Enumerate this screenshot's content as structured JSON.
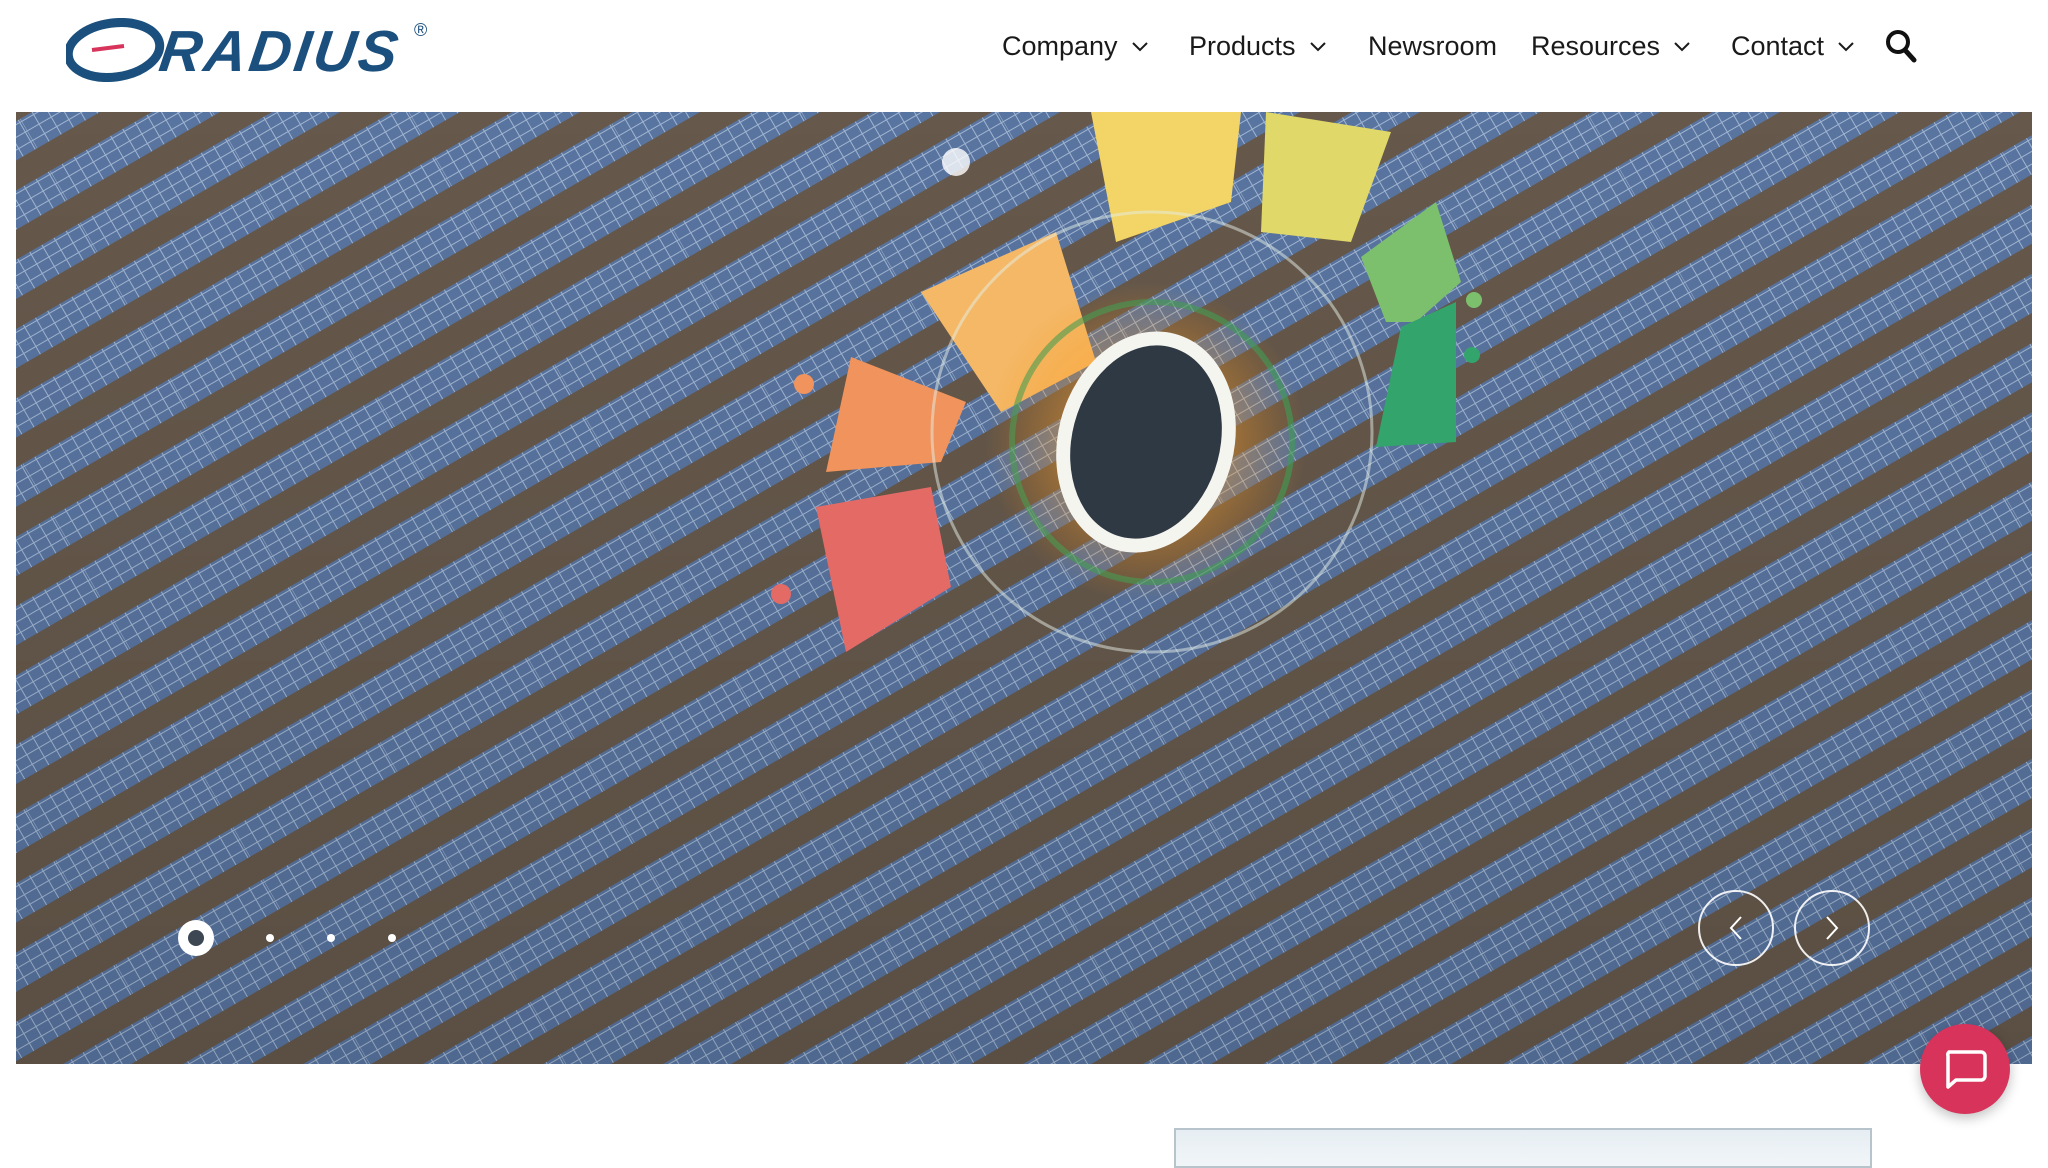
{
  "brand": {
    "logo_text": "RADIUS",
    "registered_mark": "®",
    "color": "#1b4f7d"
  },
  "nav": [
    {
      "label": "Company",
      "has_dropdown": true
    },
    {
      "label": "Products",
      "has_dropdown": true
    },
    {
      "label": "Newsroom",
      "has_dropdown": false
    },
    {
      "label": "Resources",
      "has_dropdown": true
    },
    {
      "label": "Contact",
      "has_dropdown": true
    }
  ],
  "icons": {
    "search": "search-icon",
    "dropdown": "chevron-down-icon",
    "prev": "chevron-left-icon",
    "next": "chevron-right-icon",
    "chat": "chat-bubble-icon"
  },
  "hero": {
    "slide_count": 4,
    "active_slide": 1,
    "gauge_colors": [
      "#e46a66",
      "#f0935c",
      "#f4b866",
      "#f3d466",
      "#e0d868",
      "#7cc06e",
      "#33a46b"
    ]
  },
  "colors": {
    "chat_button": "#d7335b",
    "text": "#1a1a1a"
  }
}
